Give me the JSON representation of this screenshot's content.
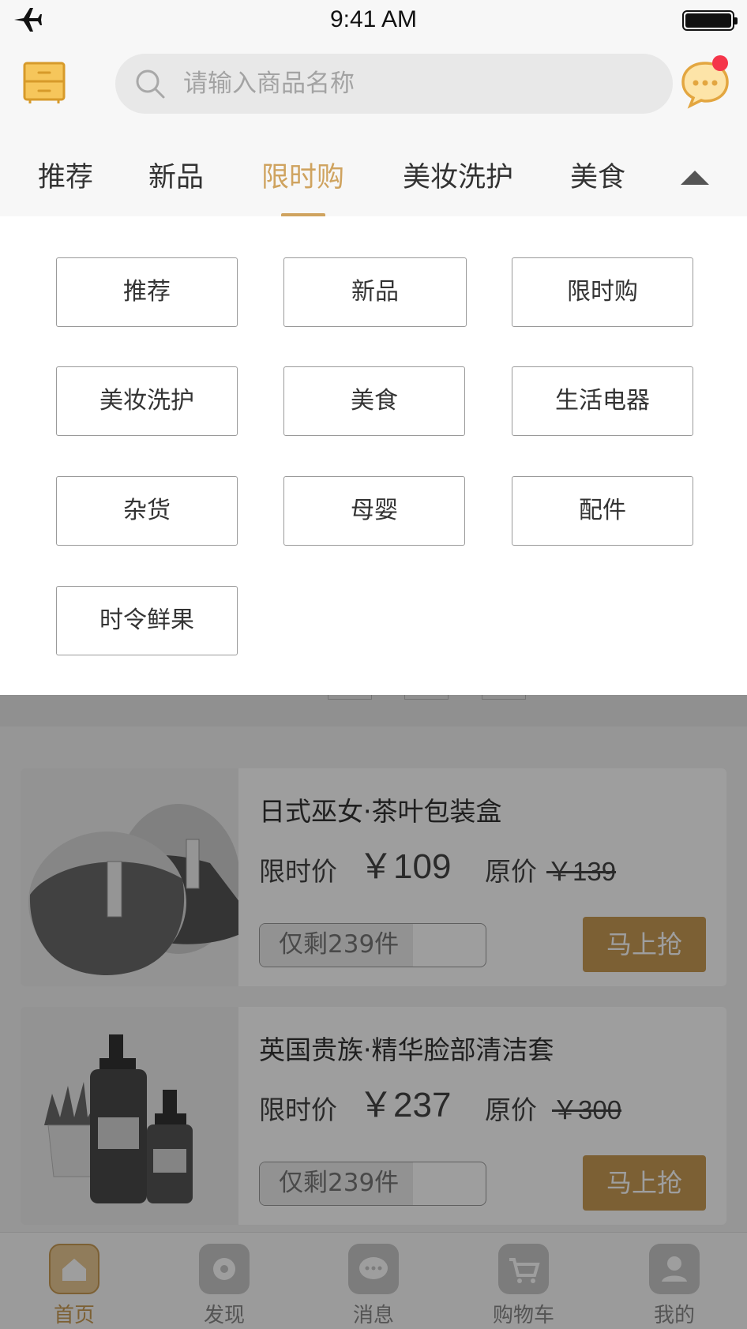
{
  "status_bar": {
    "time": "9:41 AM"
  },
  "search": {
    "placeholder": "请输入商品名称"
  },
  "tabs": [
    {
      "label": "推荐"
    },
    {
      "label": "新品"
    },
    {
      "label": "限时购",
      "active": true
    },
    {
      "label": "美妆洗护"
    },
    {
      "label": "美食"
    }
  ],
  "categories": [
    {
      "label": "推荐"
    },
    {
      "label": "新品"
    },
    {
      "label": "限时购"
    },
    {
      "label": "美妆洗护"
    },
    {
      "label": "美食"
    },
    {
      "label": "生活电器"
    },
    {
      "label": "杂货"
    },
    {
      "label": "母婴"
    },
    {
      "label": "配件"
    },
    {
      "label": "时令鲜果"
    }
  ],
  "products": [
    {
      "title": "日式巫女·茶叶包装盒",
      "price_label": "限时价",
      "price": "￥109",
      "orig_label": "原价",
      "orig_price": "￥139",
      "stock_text": "仅剩239件",
      "stock_fraction": 0.68,
      "buy_label": "马上抢",
      "image_icon": "stone-tea-box-image"
    },
    {
      "title": "英国贵族·精华脸部清洁套",
      "price_label": "限时价",
      "price": "￥237",
      "orig_label": "原价",
      "orig_price": "￥300",
      "stock_text": "仅剩239件",
      "stock_fraction": 0.68,
      "buy_label": "马上抢",
      "image_icon": "cosmetic-bottles-image"
    }
  ],
  "tabbar": [
    {
      "label": "首页",
      "icon": "home-icon",
      "active": true
    },
    {
      "label": "发现",
      "icon": "discover-icon"
    },
    {
      "label": "消息",
      "icon": "message-icon"
    },
    {
      "label": "购物车",
      "icon": "cart-icon"
    },
    {
      "label": "我的",
      "icon": "profile-icon"
    }
  ],
  "colors": {
    "accent": "#cfa35f",
    "badge": "#f5354a",
    "buy_button": "#c99b55"
  }
}
